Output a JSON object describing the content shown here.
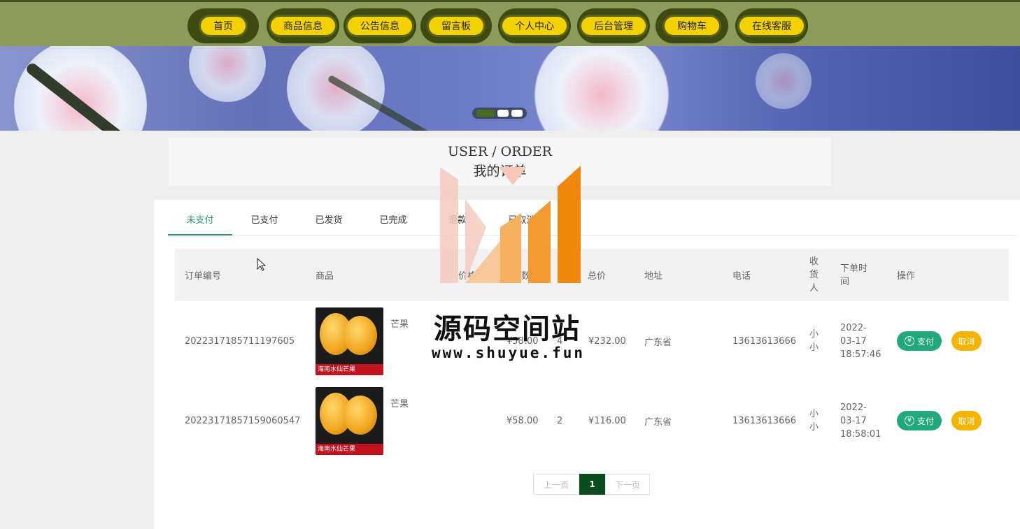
{
  "nav": {
    "items": [
      {
        "label": "首页"
      },
      {
        "label": "商品信息"
      },
      {
        "label": "公告信息"
      },
      {
        "label": "留言板"
      },
      {
        "label": "个人中心"
      },
      {
        "label": "后台管理"
      },
      {
        "label": "购物车"
      },
      {
        "label": "在线客服"
      }
    ],
    "colors": {
      "bar": "#8c9a5b",
      "pill": "#f3d200",
      "ring": "#3f4a12"
    }
  },
  "banner": {
    "slides": 3,
    "active_slide": 1
  },
  "title": {
    "en": "USER / ORDER",
    "cn": "我的订单"
  },
  "tabs": [
    {
      "label": "未支付",
      "active": true
    },
    {
      "label": "已支付"
    },
    {
      "label": "已发货"
    },
    {
      "label": "已完成"
    },
    {
      "label": "退款"
    },
    {
      "label": "已取消"
    }
  ],
  "table": {
    "headers": [
      "订单编号",
      "商品",
      "价格",
      "数量",
      "总价",
      "地址",
      "电话",
      "收货人",
      "下单时间",
      "操作"
    ],
    "rows": [
      {
        "order_no": "2022317185711197605",
        "product": "芒果",
        "thumb_caption": "海南水仙芒果",
        "price": "¥58.00",
        "qty": "4",
        "total": "¥232.00",
        "address": "广东省",
        "phone": "13613613666",
        "receiver": "小小",
        "time": "2022-03-17 18:57:46"
      },
      {
        "order_no": "20223171857159060547",
        "product": "芒果",
        "thumb_caption": "海南水仙芒果",
        "price": "¥58.00",
        "qty": "2",
        "total": "¥116.00",
        "address": "广东省",
        "phone": "13613613666",
        "receiver": "小小",
        "time": "2022-03-17 18:58:01"
      }
    ],
    "pay_label": "支付",
    "pay_icon": "¥",
    "cancel_label": "取消"
  },
  "pager": {
    "prev": "上一页",
    "current": "1",
    "next": "下一页"
  },
  "watermark": {
    "cn": "源码空间站",
    "url": "www.shuyue.fun"
  },
  "colors": {
    "accent_green": "#2e9a6f",
    "pay": "#20a97a",
    "cancel": "#f4b400",
    "pager_current": "#0b4d1f"
  }
}
